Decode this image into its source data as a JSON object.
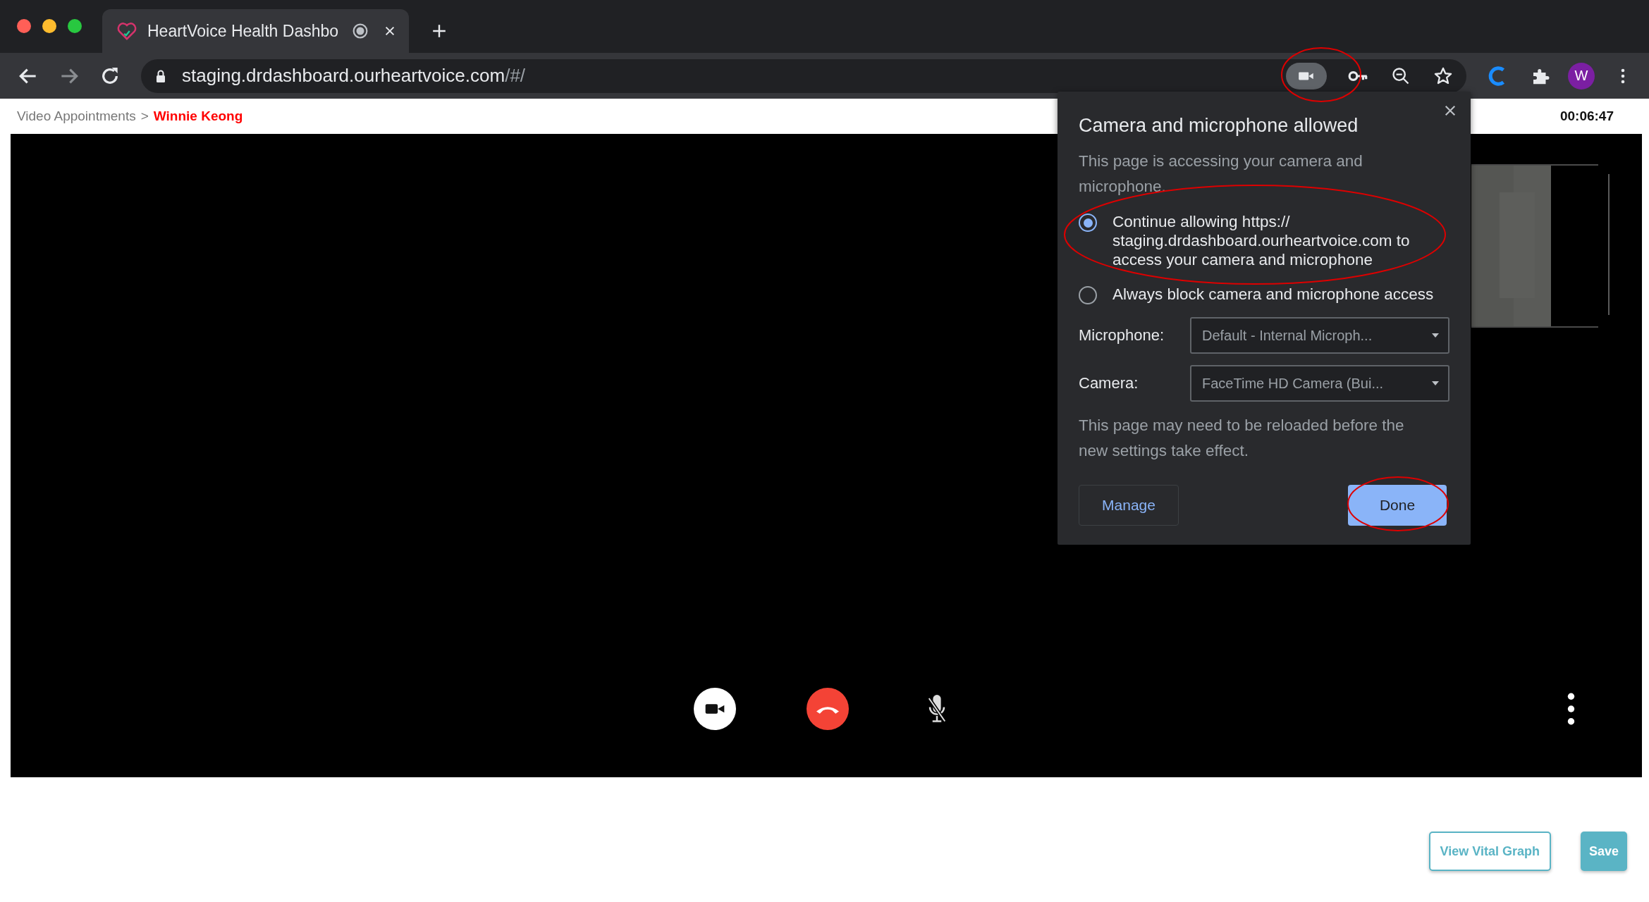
{
  "browser": {
    "tab": {
      "title": "HeartVoice Health Dashbo",
      "recording": true
    },
    "url": {
      "host": "staging.drdashboard.ourheartvoice.com",
      "path": "/#/"
    },
    "profile_initial": "W"
  },
  "breadcrumb": [
    {
      "label": "Video Appointments",
      "current": false
    },
    {
      "label": "Winnie Keong",
      "current": true
    }
  ],
  "breadcrumb_separator": ">",
  "timer": "00:06:47",
  "call_controls": [
    {
      "kind": "camera"
    },
    {
      "kind": "hangup"
    },
    {
      "kind": "mic",
      "muted": true
    },
    {
      "kind": "more"
    }
  ],
  "permission_popup": {
    "title": "Camera and microphone allowed",
    "description": "This page is accessing your camera and microphone.",
    "options": [
      {
        "label": "Continue allowing https:// staging.drdashboard.ourheartvoice.com to access your camera and microphone",
        "selected": true
      },
      {
        "label": "Always block camera and microphone access",
        "selected": false
      }
    ],
    "fields": [
      {
        "label": "Microphone:",
        "value": "Default - Internal Microph..."
      },
      {
        "label": "Camera:",
        "value": "FaceTime HD Camera (Bui..."
      }
    ],
    "note": "This page may need to be reloaded before the new settings take effect.",
    "buttons": [
      {
        "label": "Manage",
        "kind": "secondary"
      },
      {
        "label": "Done",
        "kind": "primary"
      }
    ]
  },
  "footer_buttons": [
    {
      "label": "View Vital Graph",
      "kind": "outline"
    },
    {
      "label": "Save",
      "kind": "filled"
    }
  ]
}
